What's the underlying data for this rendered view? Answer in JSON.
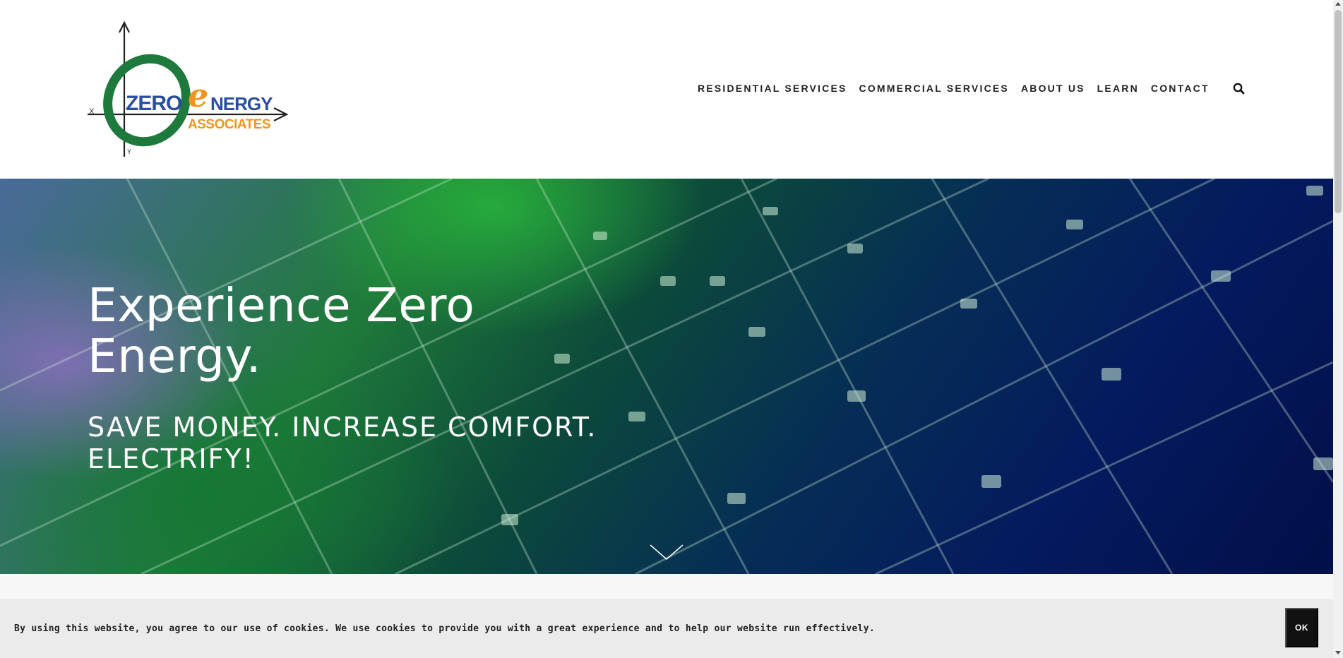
{
  "header": {
    "logo": {
      "word_zero": "ZERO",
      "letter_e": "e",
      "word_nergy": "NERGY",
      "word_associates": "ASSOCIATES",
      "axis_x": "X",
      "axis_y": "Y",
      "colors": {
        "green": "#1e7a3c",
        "blue": "#2a4ea0",
        "orange": "#f0941e"
      }
    },
    "nav": [
      {
        "label": "RESIDENTIAL SERVICES"
      },
      {
        "label": "COMMERCIAL SERVICES"
      },
      {
        "label": "ABOUT US"
      },
      {
        "label": "LEARN"
      },
      {
        "label": "CONTACT"
      }
    ],
    "search_icon": "search-icon"
  },
  "hero": {
    "title_line1": "Experience Zero",
    "title_line2": "Energy.",
    "subtitle_line1": "SAVE MONEY. INCREASE COMFORT.",
    "subtitle_line2": "ELECTRIFY!",
    "scroll_icon": "chevron-down-icon"
  },
  "cookie_banner": {
    "text": "By using this website, you agree to our use of cookies. We use cookies to provide you with a great experience and to help our website run effectively.",
    "button_label": "OK"
  }
}
